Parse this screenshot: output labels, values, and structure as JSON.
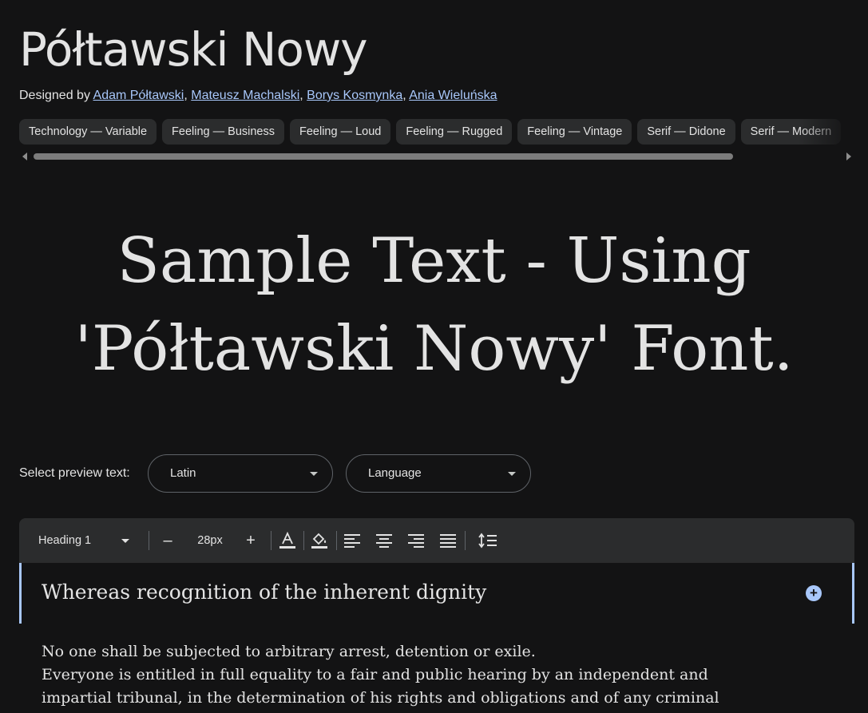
{
  "font": {
    "title": "Półtawski Nowy",
    "designed_by_label": "Designed by",
    "designers": [
      "Adam Półtawski",
      "Mateusz Machalski",
      "Borys Kosmynka",
      "Ania Wieluńska"
    ],
    "separator": ", "
  },
  "tags": [
    "Technology — Variable",
    "Feeling — Business",
    "Feeling — Loud",
    "Feeling — Rugged",
    "Feeling — Vintage",
    "Serif — Didone",
    "Serif — Modern"
  ],
  "sample": {
    "line1": "Sample Text - Using",
    "line2": "'Półtawski Nowy' Font."
  },
  "preview": {
    "label": "Select preview text:",
    "script_value": "Latin",
    "language_value": "Language"
  },
  "toolbar": {
    "style_value": "Heading 1",
    "decrease": "–",
    "size_value": "28px",
    "increase": "+"
  },
  "editor": {
    "heading": "Whereas recognition of the inherent dignity",
    "add_symbol": "+",
    "paragraph_lines": [
      "No one shall be subjected to arbitrary arrest, detention or exile.",
      "Everyone is entitled in full equality to a fair and public hearing by an independent and",
      "impartial tribunal, in the determination of his rights and obligations and of any criminal"
    ]
  },
  "colors": {
    "background": "#131314",
    "link": "#a8c7fa",
    "chip": "#2b2c2d",
    "accent": "#a8c7fa"
  }
}
